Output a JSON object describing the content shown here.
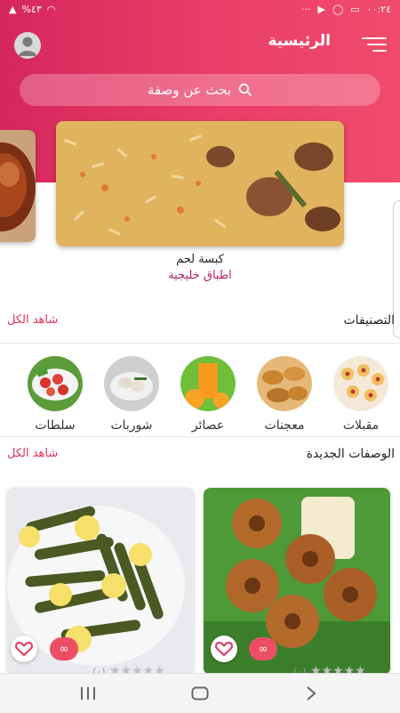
{
  "status": {
    "time": "٠٠:٢٤",
    "battery": "%٤٣",
    "dots": "···"
  },
  "header": {
    "title": "الرئيسية"
  },
  "search": {
    "placeholder": "بحث عن وصفة"
  },
  "featured": {
    "title": "كبسة لحم",
    "category": "اطباق خليجية"
  },
  "categories": {
    "title": "التصنيفات",
    "see_all": "شاهد الكل",
    "items": [
      {
        "label": "مقبلات"
      },
      {
        "label": "معجنات"
      },
      {
        "label": "عصائر"
      },
      {
        "label": "شوربات"
      },
      {
        "label": "سلطات"
      }
    ]
  },
  "new_recipes": {
    "title": "الوصفات الجديدة",
    "see_all": "شاهد الكل",
    "cards": [
      {
        "badge": "∞",
        "stars": "★★★★★",
        "reviews": "(٠)"
      },
      {
        "badge": "∞",
        "stars": "★★★★★",
        "reviews": "(٠)"
      }
    ]
  },
  "colors": {
    "accent": "#e0335a",
    "hero_start": "#d6275e",
    "hero_end": "#f04b6b"
  },
  "icons": [
    "menu-icon",
    "avatar-icon",
    "search-icon",
    "heart-icon",
    "recents-icon",
    "home-icon",
    "back-icon"
  ]
}
